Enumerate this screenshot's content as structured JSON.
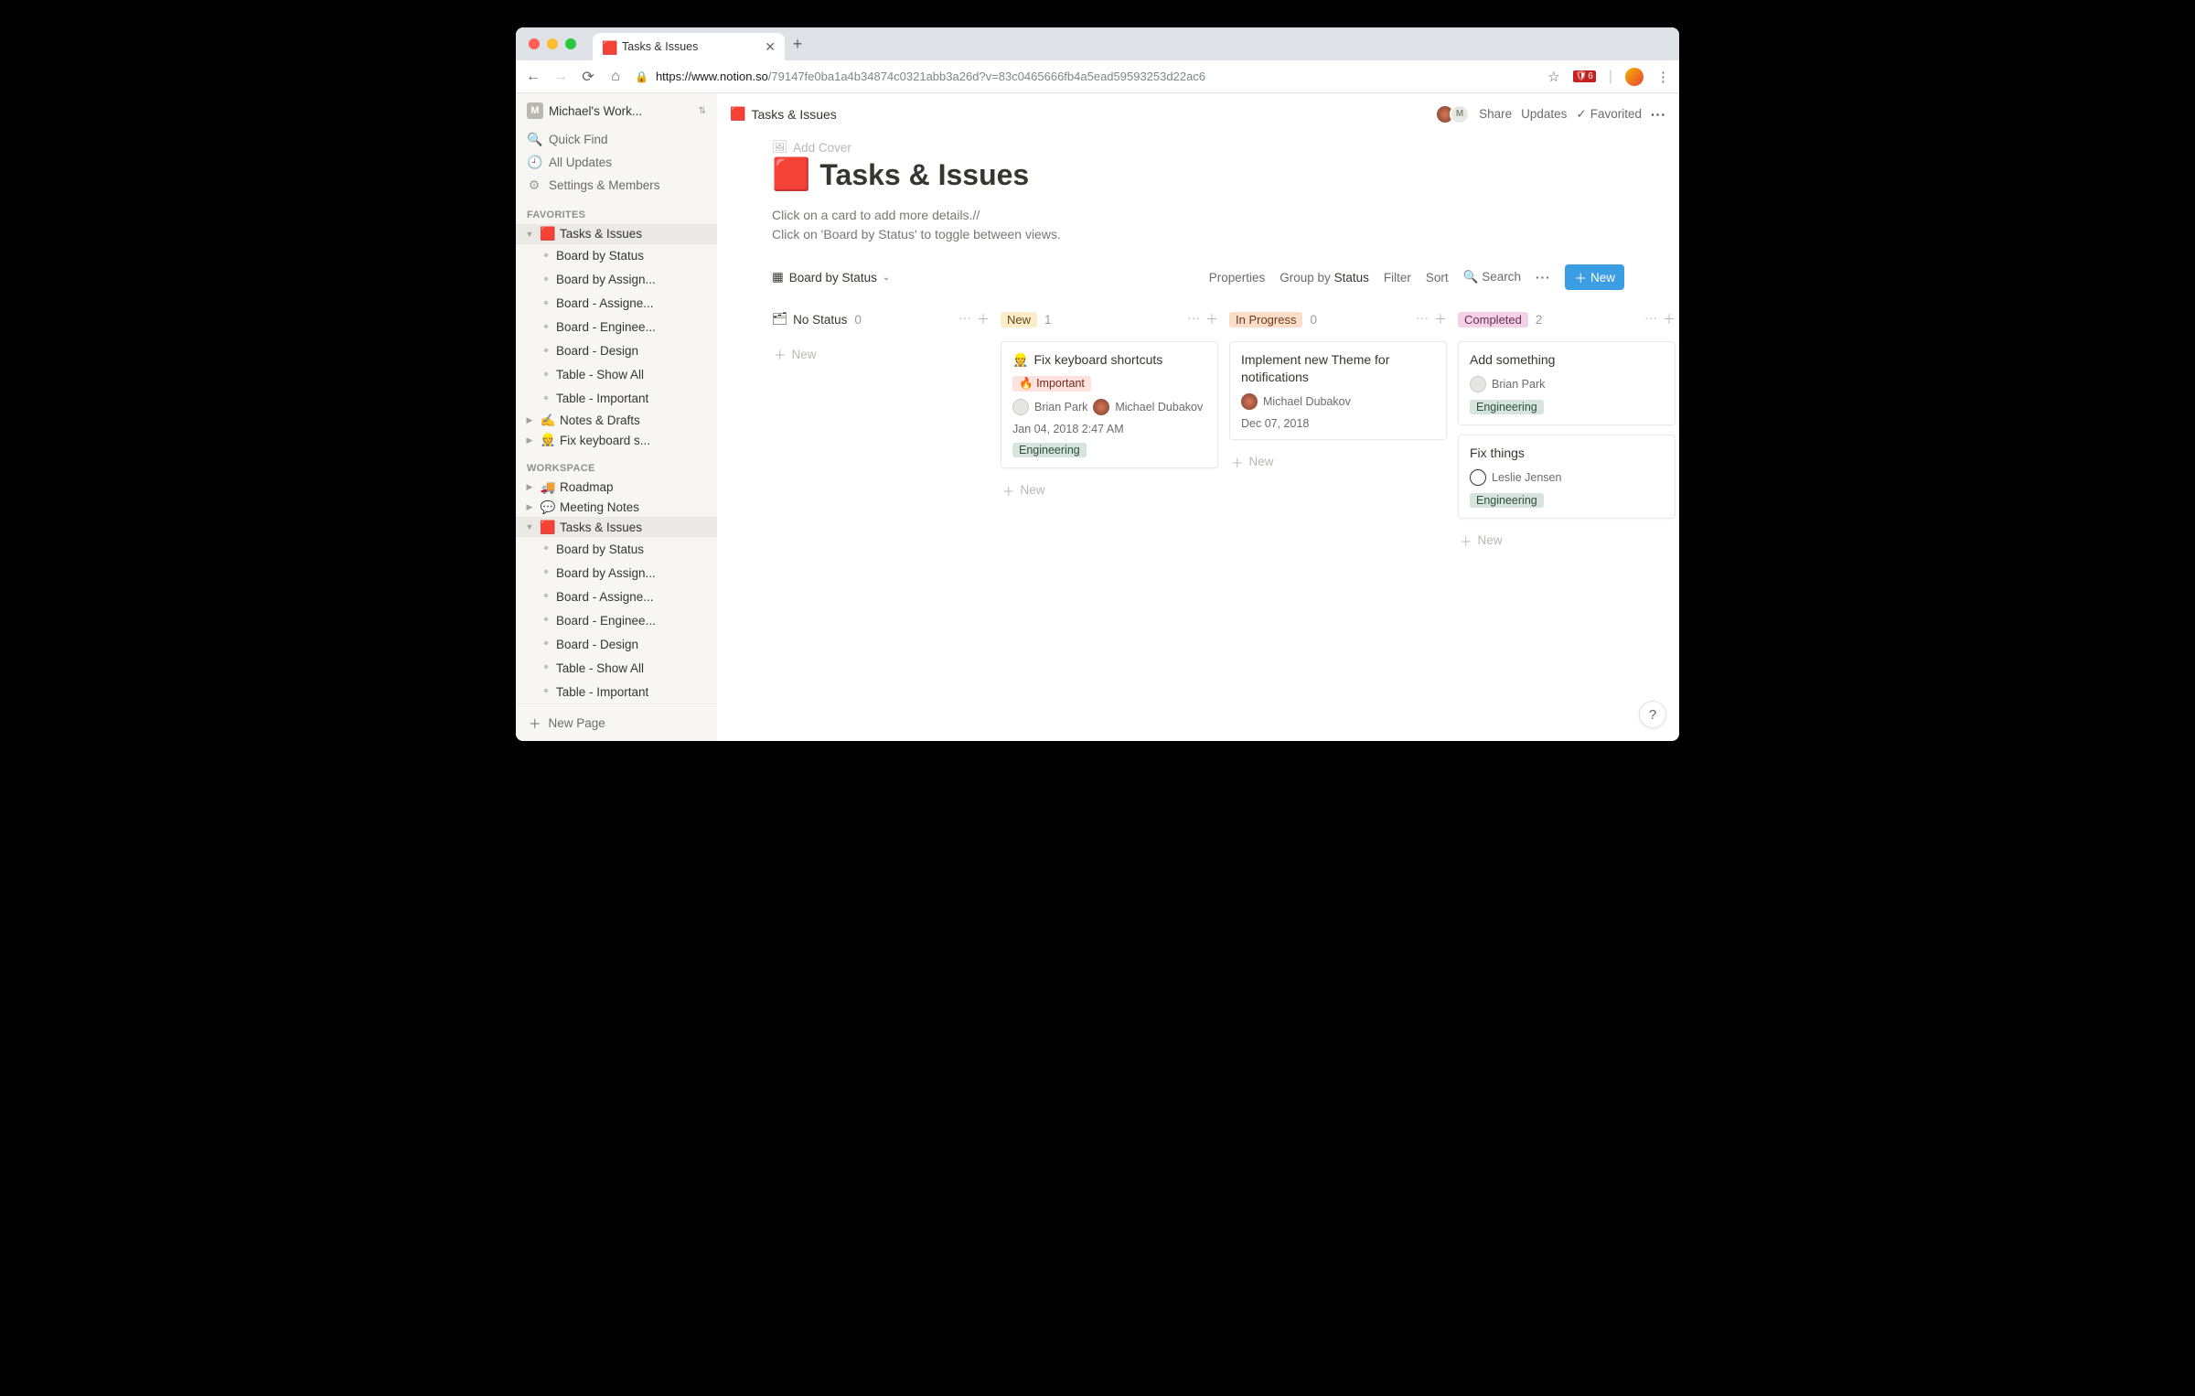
{
  "browser": {
    "tab_title": "Tasks & Issues",
    "url_host": "https://www.notion.so",
    "url_path": "/79147fe0ba1a4b34874c0321abb3a26d?v=83c0465666fb4a5ead59593253d22ac6",
    "ext_badge": "6"
  },
  "sidebar": {
    "workspace_name": "Michael's Work...",
    "quick_find": "Quick Find",
    "all_updates": "All Updates",
    "settings": "Settings & Members",
    "favorites_header": "FAVORITES",
    "workspace_header": "WORKSPACE",
    "new_page": "New Page",
    "fav_tasks": "Tasks & Issues",
    "fav_children": [
      "Board by Status",
      "Board by Assign...",
      "Board - Assigne...",
      "Board - Enginee...",
      "Board - Design",
      "Table - Show All",
      "Table - Important"
    ],
    "fav_notes": "Notes & Drafts",
    "fav_fix": "Fix keyboard s...",
    "ws_roadmap": "Roadmap",
    "ws_meeting": "Meeting Notes",
    "ws_tasks": "Tasks & Issues",
    "ws_children": [
      "Board by Status",
      "Board by Assign...",
      "Board - Assigne...",
      "Board - Enginee...",
      "Board - Design",
      "Table - Show All",
      "Table - Important"
    ]
  },
  "header": {
    "breadcrumb": "Tasks & Issues",
    "share": "Share",
    "updates": "Updates",
    "favorited": "Favorited"
  },
  "page": {
    "add_cover": "Add Cover",
    "title": "Tasks & Issues",
    "sub1": "Click on a card to add more details.//",
    "sub2": "Click on 'Board by Status' to toggle between views."
  },
  "viewbar": {
    "view_name": "Board by Status",
    "properties": "Properties",
    "groupby_label": "Group by",
    "groupby_value": "Status",
    "filter": "Filter",
    "sort": "Sort",
    "search": "Search",
    "new": "New"
  },
  "columns": {
    "nostatus": {
      "label": "No Status",
      "count": "0"
    },
    "new": {
      "label": "New",
      "count": "1"
    },
    "inprog": {
      "label": "In Progress",
      "count": "0"
    },
    "completed": {
      "label": "Completed",
      "count": "2"
    },
    "addgroup": "Add"
  },
  "cards": {
    "newcol_new": "New",
    "c1": {
      "title": "Fix keyboard shortcuts",
      "tag_important": "Important",
      "p1": "Brian Park",
      "p2": "Michael Dubakov",
      "date": "Jan 04, 2018 2:47 AM",
      "tag_eng": "Engineering"
    },
    "c2": {
      "title": "Implement new Theme for notifications",
      "p1": "Michael Dubakov",
      "date": "Dec 07, 2018"
    },
    "c3": {
      "title": "Add something",
      "p1": "Brian Park",
      "tag_eng": "Engineering"
    },
    "c4": {
      "title": "Fix things",
      "p1": "Leslie Jensen",
      "tag_eng": "Engineering"
    }
  },
  "icons": {
    "fire": "🔥",
    "builder": "👷",
    "writing": "✍️",
    "truck": "🚚",
    "speech": "💬"
  },
  "colors": {
    "accent": "#3b9ee3"
  }
}
